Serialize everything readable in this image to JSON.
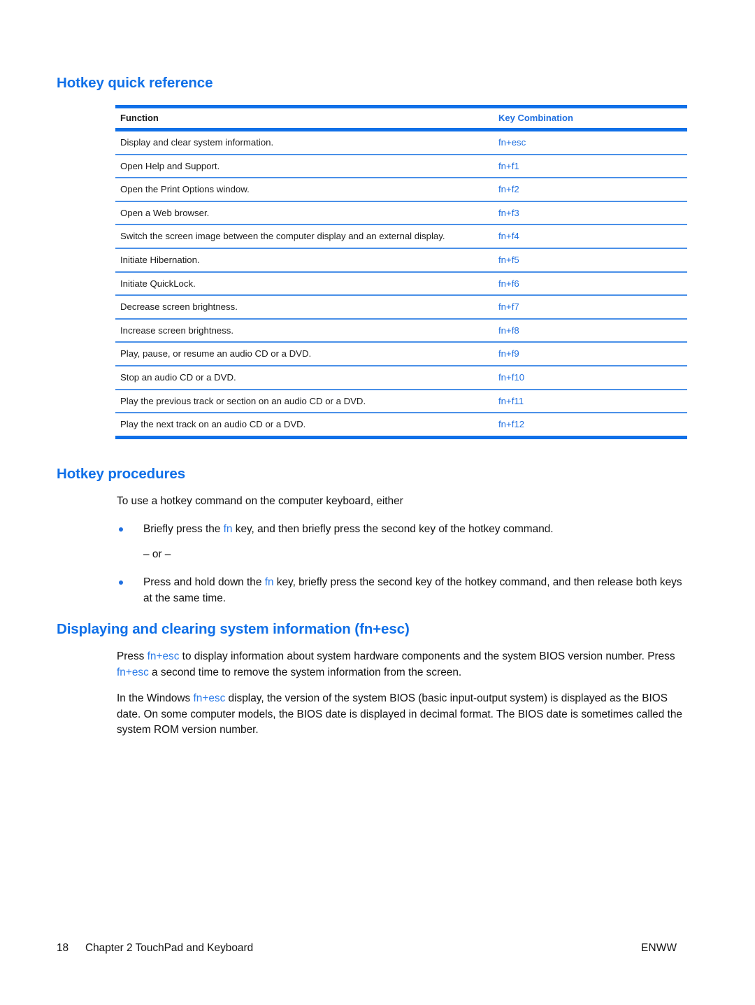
{
  "colors": {
    "heading_blue": "#1070e8",
    "rule_blue": "#1070e8",
    "row_rule_blue": "#4a90e8",
    "key_blue": "#1f6fe0",
    "body_text": "#111111"
  },
  "sections": {
    "quick_reference_title": "Hotkey quick reference",
    "procedures_title": "Hotkey procedures",
    "display_clear_title": "Displaying and clearing system information (fn+esc)"
  },
  "table": {
    "headers": {
      "function": "Function",
      "key_combination": "Key Combination"
    },
    "rows": [
      {
        "function": "Display and clear system information.",
        "key": "fn+esc"
      },
      {
        "function": "Open Help and Support.",
        "key": "fn+f1"
      },
      {
        "function": "Open the Print Options window.",
        "key": "fn+f2"
      },
      {
        "function": "Open a Web browser.",
        "key": "fn+f3"
      },
      {
        "function": "Switch the screen image between the computer display and an external display.",
        "key": "fn+f4"
      },
      {
        "function": "Initiate Hibernation.",
        "key": "fn+f5"
      },
      {
        "function": "Initiate QuickLock.",
        "key": "fn+f6"
      },
      {
        "function": "Decrease screen brightness.",
        "key": "fn+f7"
      },
      {
        "function": "Increase screen brightness.",
        "key": "fn+f8"
      },
      {
        "function": "Play, pause, or resume an audio CD or a DVD.",
        "key": "fn+f9"
      },
      {
        "function": "Stop an audio CD or a DVD.",
        "key": "fn+f10"
      },
      {
        "function": "Play the previous track or section on an audio CD or a DVD.",
        "key": "fn+f11"
      },
      {
        "function": "Play the next track on an audio CD or a DVD.",
        "key": "fn+f12"
      }
    ]
  },
  "procedures": {
    "intro": "To use a hotkey command on the computer keyboard, either",
    "bullet1_part1": "Briefly press the ",
    "bullet1_key": "fn",
    "bullet1_part2": " key, and then briefly press the second key of the hotkey command.",
    "or_text": "– or –",
    "bullet2_part1": "Press and hold down the ",
    "bullet2_key": "fn",
    "bullet2_part2": " key, briefly press the second key of the hotkey command, and then release both keys at the same time."
  },
  "display_clear": {
    "para1_part1": "Press ",
    "para1_key1": "fn+esc",
    "para1_part2": " to display information about system hardware components and the system BIOS version number. Press ",
    "para1_key2": "fn+esc",
    "para1_part3": " a second time to remove the system information from the screen.",
    "para2_part1": "In the Windows ",
    "para2_key1": "fn+esc",
    "para2_part2": " display, the version of the system BIOS (basic input-output system) is displayed as the BIOS date. On some computer models, the BIOS date is displayed in decimal format. The BIOS date is sometimes called the system ROM version number."
  },
  "footer": {
    "page_number": "18",
    "chapter": "Chapter 2   TouchPad and Keyboard",
    "locale": "ENWW"
  }
}
